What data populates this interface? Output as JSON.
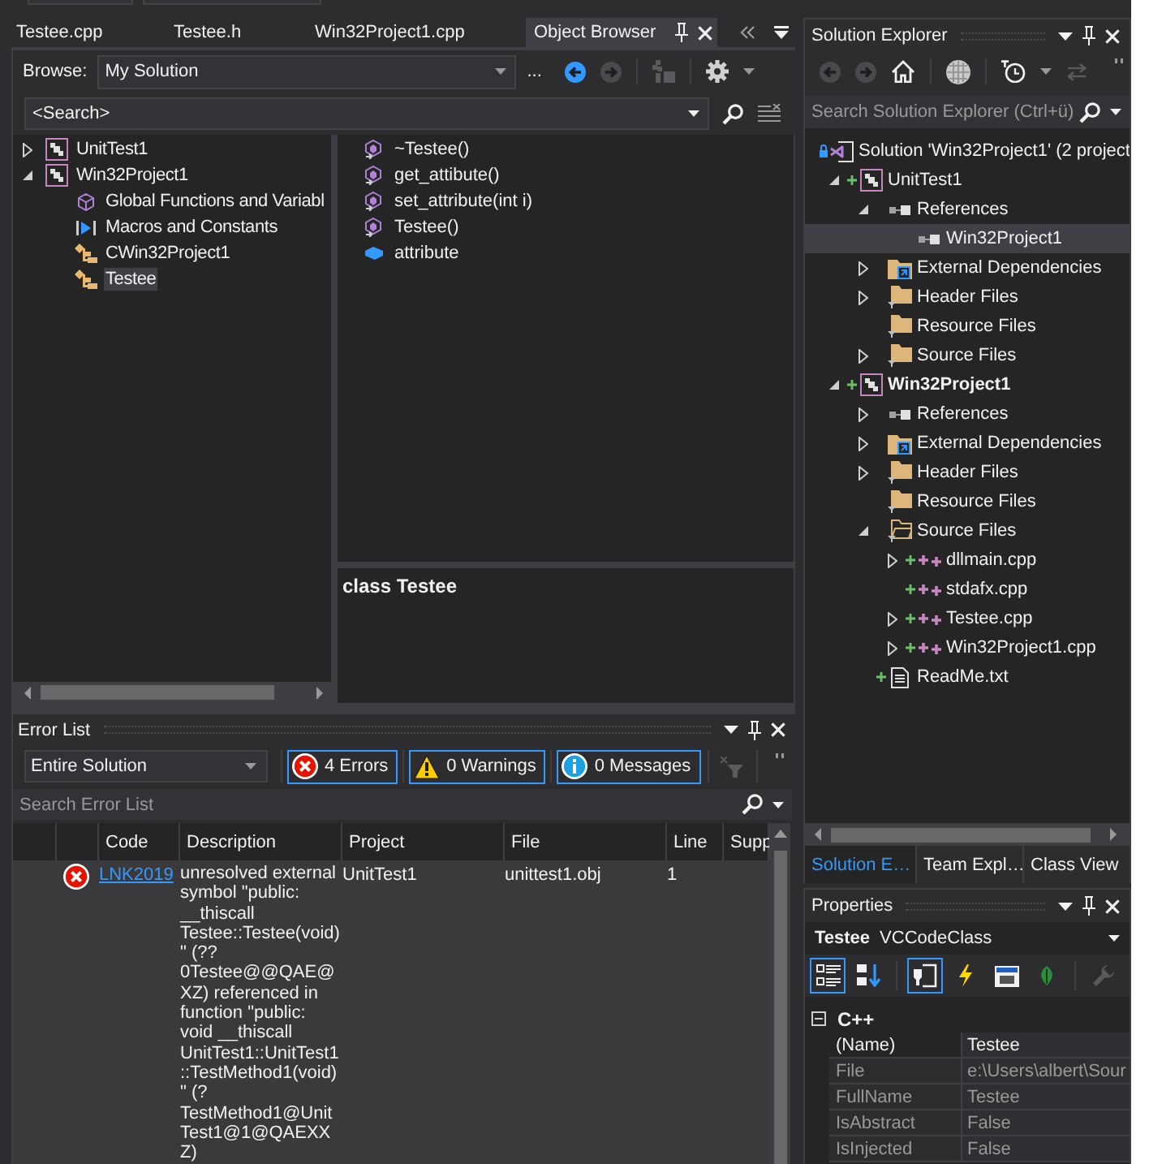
{
  "document_tabs": [
    {
      "label": "Testee.cpp",
      "selected": false
    },
    {
      "label": "Testee.h",
      "selected": false
    },
    {
      "label": "Win32Project1.cpp",
      "selected": false
    },
    {
      "label": "Object Browser",
      "selected": true
    }
  ],
  "object_browser": {
    "browse_label": "Browse:",
    "browse_scope": "My Solution",
    "more_button": "...",
    "toolbar": [
      {
        "kind": "back",
        "disabled": false
      },
      {
        "kind": "forward",
        "disabled": true
      },
      {
        "kind": "add_reference",
        "disabled": true
      },
      {
        "kind": "settings",
        "disabled": false
      }
    ],
    "search": {
      "value": "<Search>"
    },
    "tree": [
      {
        "label": "UnitTest1",
        "kind": "project",
        "expanded": false,
        "selected": false
      },
      {
        "label": "Win32Project1",
        "kind": "project",
        "expanded": true,
        "selected": false,
        "children": [
          {
            "label": "Global Functions and Variabl",
            "kind": "globals",
            "selected": false
          },
          {
            "label": "Macros and Constants",
            "kind": "macros",
            "selected": false
          },
          {
            "label": "CWin32Project1",
            "kind": "class",
            "selected": false
          },
          {
            "label": "Testee",
            "kind": "class",
            "selected": true
          }
        ]
      }
    ],
    "members": [
      {
        "label": "~Testee()",
        "kind": "method"
      },
      {
        "label": "get_attibute()",
        "kind": "method"
      },
      {
        "label": "set_attribute(int i)",
        "kind": "method"
      },
      {
        "label": "Testee()",
        "kind": "method"
      },
      {
        "label": "attribute",
        "kind": "field"
      }
    ],
    "description": "class Testee"
  },
  "error_list": {
    "title": "Error List",
    "scope": "Entire Solution",
    "filters": [
      {
        "kind": "error",
        "label": "4 Errors",
        "selected": true
      },
      {
        "kind": "warning",
        "label": "0 Warnings",
        "selected": true
      },
      {
        "kind": "message",
        "label": "0 Messages",
        "selected": true
      }
    ],
    "filter_button": {
      "disabled": true
    },
    "search": {
      "placeholder": "Search Error List"
    },
    "columns": [
      "Code",
      "Description",
      "Project",
      "File",
      "Line",
      "Supp"
    ],
    "rows": [
      {
        "kind": "error",
        "code": "LNK2019",
        "description": "unresolved external symbol \"public: __thiscall Testee::Testee(void)\" (??0Testee@@QAE@XZ) referenced in function \"public: void __thiscall UnitTest1::UnitTest1::TestMethod1(void)\" (?TestMethod1@UnitTest1@1@QAEXXZ)",
        "project": "UnitTest1",
        "file": "unittest1.obj",
        "line": "1"
      }
    ]
  },
  "solution_explorer": {
    "title": "Solution Explorer",
    "toolbar": [
      {
        "kind": "back",
        "disabled": true
      },
      {
        "kind": "forward",
        "disabled": true
      },
      {
        "kind": "home",
        "disabled": false
      },
      {
        "kind": "show_all",
        "disabled": false
      },
      {
        "kind": "pending_changes",
        "disabled": false
      },
      {
        "kind": "sync",
        "disabled": true
      }
    ],
    "search": {
      "placeholder": "Search Solution Explorer (Ctrl+ü)"
    },
    "tree": [
      {
        "label": "Solution 'Win32Project1' (2 project",
        "kind": "solution",
        "locked": true,
        "selected": false,
        "children": [
          {
            "label": "UnitTest1",
            "kind": "project",
            "expanded": true,
            "added": true,
            "startup": false,
            "selected": false,
            "children": [
              {
                "label": "References",
                "kind": "references",
                "expanded": true,
                "selected": false,
                "children": [
                  {
                    "label": "Win32Project1",
                    "kind": "reference",
                    "selected": true
                  }
                ]
              },
              {
                "label": "External Dependencies",
                "kind": "external",
                "expanded": false,
                "selected": false
              },
              {
                "label": "Header Files",
                "kind": "filter",
                "expanded": false,
                "selected": false
              },
              {
                "label": "Resource Files",
                "kind": "filter",
                "selected": false
              },
              {
                "label": "Source Files",
                "kind": "filter",
                "expanded": false,
                "selected": false
              }
            ]
          },
          {
            "label": "Win32Project1",
            "kind": "project",
            "expanded": true,
            "added": true,
            "startup": true,
            "selected": false,
            "children": [
              {
                "label": "References",
                "kind": "references",
                "expanded": false,
                "selected": false
              },
              {
                "label": "External Dependencies",
                "kind": "external",
                "expanded": false,
                "selected": false
              },
              {
                "label": "Header Files",
                "kind": "filter",
                "expanded": false,
                "selected": false
              },
              {
                "label": "Resource Files",
                "kind": "filter",
                "selected": false
              },
              {
                "label": "Source Files",
                "kind": "filter",
                "expanded": true,
                "selected": false,
                "children": [
                  {
                    "label": "dllmain.cpp",
                    "kind": "cpp",
                    "expanded": false,
                    "added": true,
                    "selected": false
                  },
                  {
                    "label": "stdafx.cpp",
                    "kind": "cpp",
                    "added": true,
                    "selected": false
                  },
                  {
                    "label": "Testee.cpp",
                    "kind": "cpp",
                    "expanded": false,
                    "added": true,
                    "selected": false
                  },
                  {
                    "label": "Win32Project1.cpp",
                    "kind": "cpp",
                    "expanded": false,
                    "added": true,
                    "selected": false
                  }
                ]
              },
              {
                "label": "ReadMe.txt",
                "kind": "text",
                "added": true,
                "selected": false
              }
            ]
          }
        ]
      }
    ],
    "tabs": [
      {
        "label": "Solution E…",
        "selected": true
      },
      {
        "label": "Team Expl…",
        "selected": false
      },
      {
        "label": "Class View",
        "selected": false
      }
    ]
  },
  "properties": {
    "title": "Properties",
    "object_name": "Testee",
    "object_type": "VCCodeClass",
    "toolbar": [
      {
        "kind": "categorized",
        "selected": true,
        "disabled": false
      },
      {
        "kind": "alphabetical",
        "selected": false,
        "disabled": false
      },
      {
        "kind": "properties",
        "selected": true,
        "disabled": false
      },
      {
        "kind": "events",
        "selected": false,
        "disabled": false
      },
      {
        "kind": "messages",
        "selected": false,
        "disabled": false
      },
      {
        "kind": "overrides",
        "selected": false,
        "disabled": false
      },
      {
        "kind": "property_pages",
        "selected": false,
        "disabled": true
      }
    ],
    "categories": [
      {
        "label": "C++",
        "expanded": true,
        "rows": [
          {
            "name": "(Name)",
            "value": "Testee",
            "read_only": false
          },
          {
            "name": "File",
            "value": "e:\\Users\\albert\\Sour",
            "read_only": true
          },
          {
            "name": "FullName",
            "value": "Testee",
            "read_only": true
          },
          {
            "name": "IsAbstract",
            "value": "False",
            "read_only": true
          },
          {
            "name": "IsInjected",
            "value": "False",
            "read_only": true
          }
        ]
      }
    ]
  }
}
